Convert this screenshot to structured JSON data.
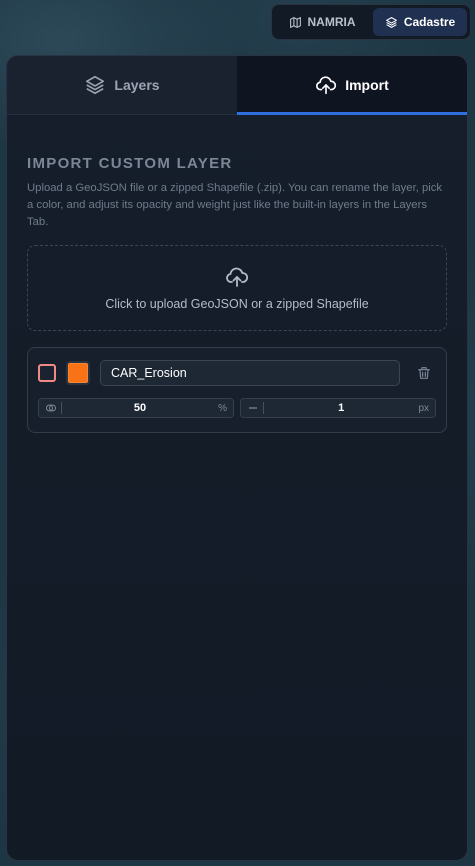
{
  "topbar": {
    "buttons": [
      {
        "label": "NAMRIA",
        "icon": "map-icon",
        "active": false
      },
      {
        "label": "Cadastre",
        "icon": "layers-icon",
        "active": true
      }
    ]
  },
  "tabs": [
    {
      "label": "Layers",
      "icon": "layers-icon",
      "active": false
    },
    {
      "label": "Import",
      "icon": "cloud-upload-icon",
      "active": true
    }
  ],
  "import": {
    "title": "IMPORT CUSTOM LAYER",
    "description": "Upload a GeoJSON file or a zipped Shapefile (.zip). You can rename the layer, pick a color, and adjust its opacity and weight just like the built-in layers in the Layers Tab.",
    "upload_text": "Click to upload GeoJSON or a zipped Shapefile"
  },
  "layer": {
    "name": "CAR_Erosion",
    "color": "#f97316",
    "checked": false,
    "opacity": "50",
    "opacity_unit": "%",
    "weight": "1",
    "weight_unit": "px"
  },
  "colors": {
    "accent": "#2f6fe0",
    "checkbox_border": "#f08a86"
  }
}
